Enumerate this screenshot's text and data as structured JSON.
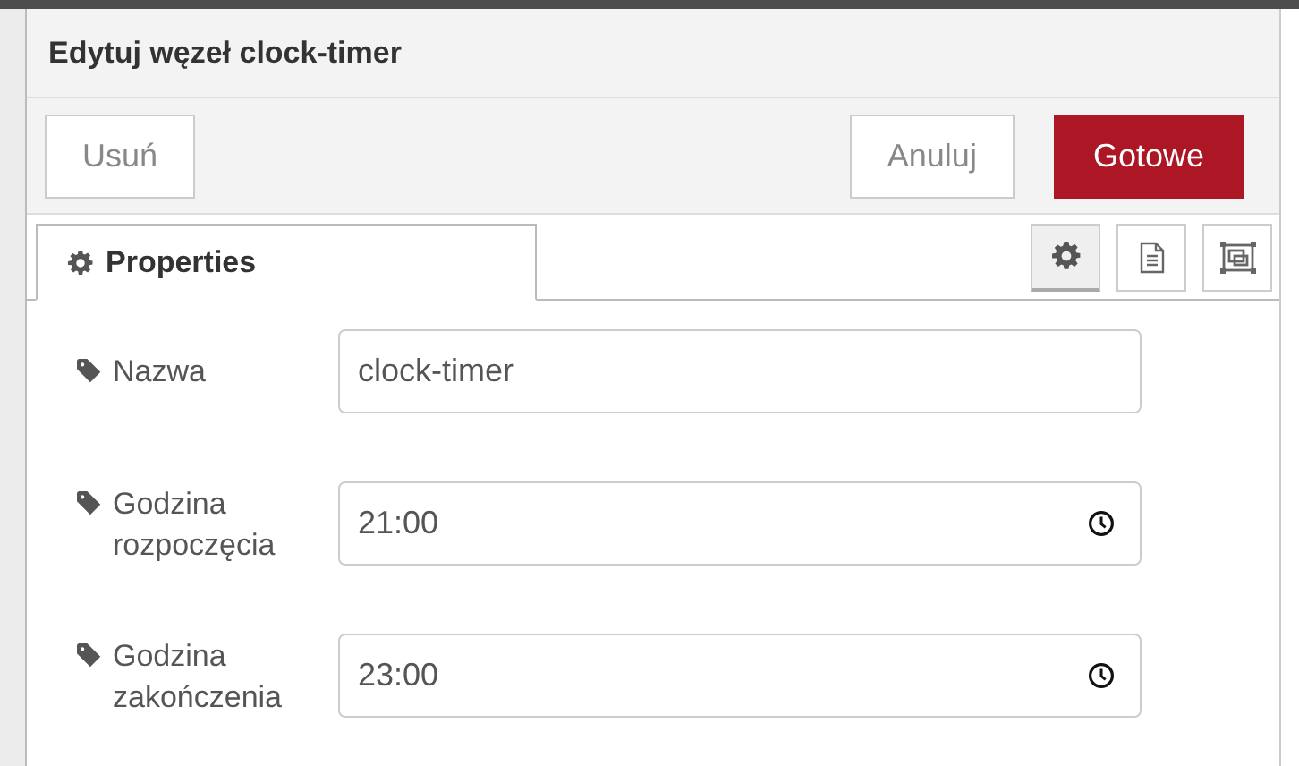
{
  "dialog": {
    "title": "Edytuj węzeł clock-timer"
  },
  "buttons": [
    {
      "label": "Usuń",
      "kind": "delete"
    },
    {
      "label": "Anuluj",
      "kind": "cancel"
    },
    {
      "label": "Gotowe",
      "kind": "primary"
    }
  ],
  "tabs": [
    {
      "label": "Properties",
      "selected": true
    }
  ],
  "tab_tools": [
    {
      "kind": "settings",
      "selected": true
    },
    {
      "kind": "description",
      "selected": false
    },
    {
      "kind": "appearance",
      "selected": false
    }
  ],
  "fields": [
    {
      "label": "Nazwa",
      "kind": "text",
      "value": "clock-timer"
    },
    {
      "label": "Godzina rozpoczęcia",
      "kind": "time",
      "value": "21:00"
    },
    {
      "label": "Godzina zakończenia",
      "kind": "time",
      "value": "23:00"
    }
  ]
}
